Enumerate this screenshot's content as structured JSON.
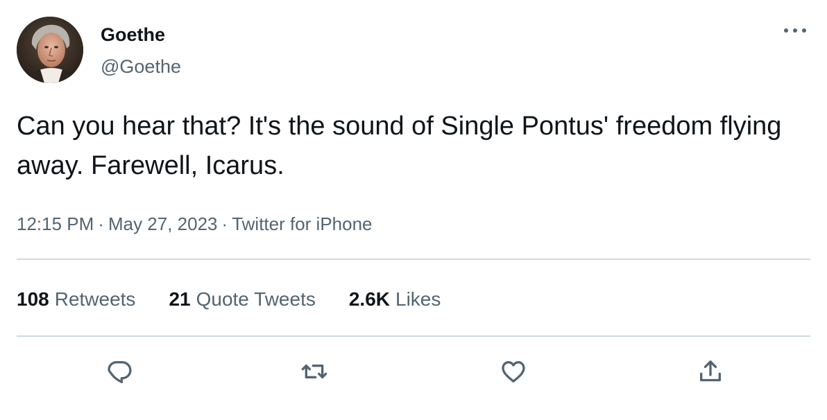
{
  "author": {
    "display_name": "Goethe",
    "handle": "@Goethe"
  },
  "tweet": {
    "text": "Can you hear that? It's the sound of Single Pontus' freedom flying away. Farewell, Icarus.",
    "time": "12:15 PM",
    "date": "May 27, 2023",
    "source": "Twitter for iPhone",
    "separator": "·"
  },
  "stats": {
    "retweets": {
      "count": "108",
      "label": "Retweets"
    },
    "quote_tweets": {
      "count": "21",
      "label": "Quote Tweets"
    },
    "likes": {
      "count": "2.6K",
      "label": "Likes"
    }
  },
  "actions": {
    "reply": "reply-icon",
    "retweet": "retweet-icon",
    "like": "heart-icon",
    "share": "share-icon"
  },
  "colors": {
    "primary_text": "#0f1419",
    "secondary_text": "#536471",
    "divider": "#cfd9de"
  }
}
